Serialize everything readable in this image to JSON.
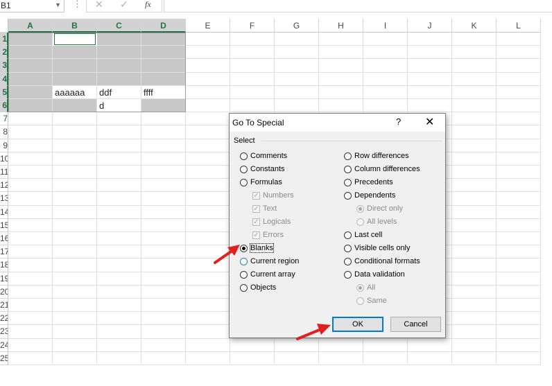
{
  "formula_bar": {
    "name_box": "B1",
    "fx_label": "fx",
    "cancel_icon": "✕",
    "enter_icon": "✓"
  },
  "columns": [
    "A",
    "B",
    "C",
    "D",
    "E",
    "F",
    "G",
    "H",
    "I",
    "J",
    "K",
    "L"
  ],
  "rows": [
    "1",
    "2",
    "3",
    "4",
    "5",
    "6",
    "7",
    "8",
    "9",
    "10",
    "11",
    "12",
    "13",
    "14",
    "15",
    "16",
    "17",
    "18",
    "19",
    "20",
    "21",
    "22",
    "23",
    "24",
    "25"
  ],
  "cells": {
    "B5": "aaaaaa",
    "C5": "ddf",
    "D5": "ffff",
    "C6": "d"
  },
  "colors": {
    "accent": "#217346",
    "selection_gray": "#c8c8c8",
    "dialog_bg": "#f0f0f0",
    "arrow": "#e02020",
    "focus_blue": "#0078d7"
  },
  "dialog": {
    "title": "Go To Special",
    "help": "?",
    "close": "✕",
    "group": "Select",
    "left_options": {
      "comments": "Comments",
      "constants": "Constants",
      "formulas": "Formulas",
      "numbers": "Numbers",
      "text": "Text",
      "logicals": "Logicals",
      "errors": "Errors",
      "blanks": "Blanks",
      "current_region": "Current region",
      "current_array": "Current array",
      "objects": "Objects"
    },
    "right_options": {
      "row_differences": "Row differences",
      "column_differences": "Column differences",
      "precedents": "Precedents",
      "dependents": "Dependents",
      "direct_only": "Direct only",
      "all_levels": "All levels",
      "last_cell": "Last cell",
      "visible_cells_only": "Visible cells only",
      "conditional_formats": "Conditional formats",
      "data_validation": "Data validation",
      "all": "All",
      "same": "Same"
    },
    "selected": "Blanks",
    "ok": "OK",
    "cancel": "Cancel"
  }
}
